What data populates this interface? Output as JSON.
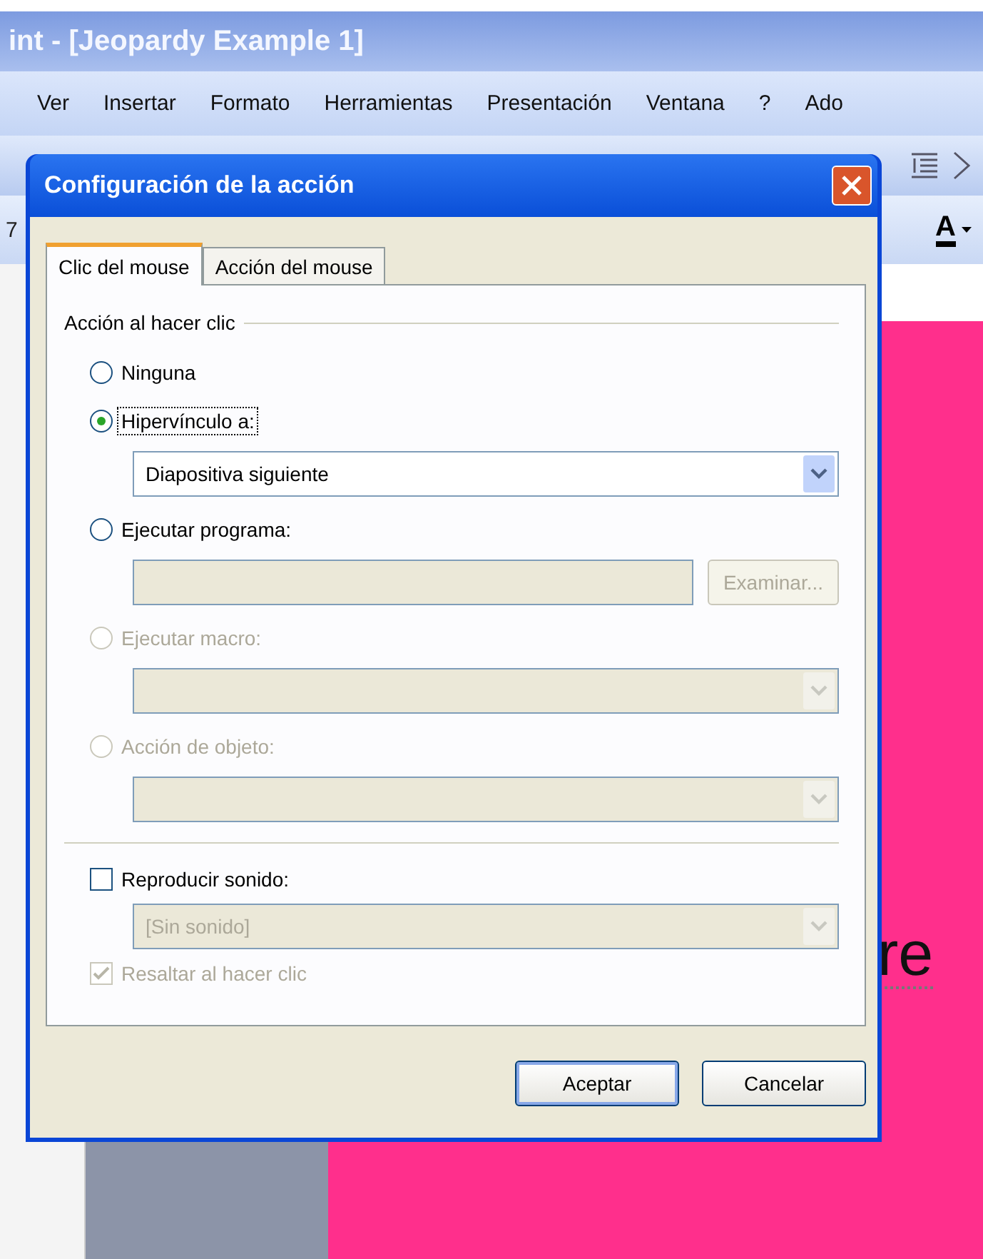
{
  "app_window": {
    "title": "int - [Jeopardy Example 1]",
    "menu": [
      {
        "label": "Ver"
      },
      {
        "label": "Insertar"
      },
      {
        "label": "Formato"
      },
      {
        "label": "Herramientas"
      },
      {
        "label": "Presentación"
      },
      {
        "label": "Ventana"
      },
      {
        "label": "?"
      },
      {
        "label": "Ado"
      }
    ],
    "format_bar_text": "7",
    "font_color_label": "A",
    "slide_text": "re"
  },
  "dialog": {
    "title": "Configuración de la acción",
    "tabs": [
      {
        "label": "Clic del mouse",
        "selected": true
      },
      {
        "label": "Acción del mouse",
        "selected": false
      }
    ],
    "group_label": "Acción al hacer clic",
    "options": [
      {
        "label": "Ninguna",
        "selected": false,
        "disabled": false,
        "focused": false
      },
      {
        "label": "Hipervínculo a:",
        "selected": true,
        "disabled": false,
        "focused": true,
        "control": {
          "kind": "dropdown",
          "value": "Diapositiva siguiente",
          "disabled": false
        }
      },
      {
        "label": "Ejecutar programa:",
        "selected": false,
        "disabled": false,
        "focused": false,
        "control": {
          "kind": "field",
          "disabled": true
        },
        "button": {
          "label": "Examinar...",
          "disabled": true
        }
      },
      {
        "label": "Ejecutar macro:",
        "selected": false,
        "disabled": true,
        "focused": false,
        "control": {
          "kind": "dropdown",
          "disabled": true
        }
      },
      {
        "label": "Acción de objeto:",
        "selected": false,
        "disabled": true,
        "focused": false,
        "control": {
          "kind": "dropdown",
          "disabled": true
        }
      }
    ],
    "sound": {
      "label": "Reproducir sonido:",
      "checked": false,
      "disabled": false,
      "control": {
        "kind": "dropdown",
        "value": "[Sin sonido]",
        "disabled": true
      }
    },
    "highlight": {
      "label": "Resaltar al hacer clic",
      "checked": true,
      "disabled": true
    },
    "buttons": [
      {
        "label": "Aceptar",
        "default": true
      },
      {
        "label": "Cancelar",
        "default": false
      }
    ]
  }
}
